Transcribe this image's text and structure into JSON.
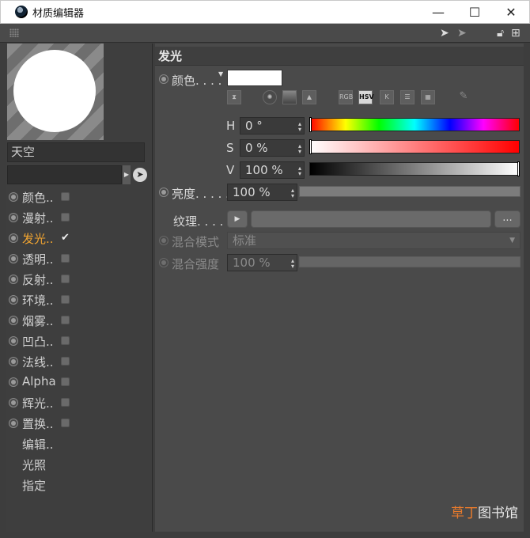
{
  "window": {
    "title": "材质编辑器",
    "controls": {
      "minimize": "—",
      "maximize": "☐",
      "close": "✕"
    }
  },
  "preview": {
    "material_name": "天空"
  },
  "channels": [
    {
      "label": "颜色..",
      "checked": false,
      "active": false
    },
    {
      "label": "漫射..",
      "checked": false,
      "active": false
    },
    {
      "label": "发光..",
      "checked": true,
      "active": true
    },
    {
      "label": "透明..",
      "checked": false,
      "active": false
    },
    {
      "label": "反射..",
      "checked": false,
      "active": false
    },
    {
      "label": "环境..",
      "checked": false,
      "active": false
    },
    {
      "label": "烟雾..",
      "checked": false,
      "active": false
    },
    {
      "label": "凹凸..",
      "checked": false,
      "active": false
    },
    {
      "label": "法线..",
      "checked": false,
      "active": false
    },
    {
      "label": "Alpha",
      "checked": false,
      "active": false
    },
    {
      "label": "辉光..",
      "checked": false,
      "active": false
    },
    {
      "label": "置换..",
      "checked": false,
      "active": false
    }
  ],
  "extra_items": [
    "编辑..",
    "光照",
    "指定"
  ],
  "section": {
    "title": "发光",
    "color_label": "颜色. . . .",
    "color_value": "#ffffff",
    "mode_buttons": [
      "RGB",
      "HSV",
      "K"
    ],
    "mode_selected": "HSV",
    "h": {
      "label": "H",
      "value": "0 °",
      "fraction": 0.0
    },
    "s": {
      "label": "S",
      "value": "0 %",
      "fraction": 0.0
    },
    "v": {
      "label": "V",
      "value": "100 %",
      "fraction": 1.0
    },
    "brightness_label": "亮度. . . . .",
    "brightness_value": "100 %",
    "texture_label": "纹理. . . . .",
    "texture_more": "...",
    "blend_mode_label": "混合模式",
    "blend_mode_value": "标准",
    "blend_strength_label": "混合强度",
    "blend_strength_value": "100 %"
  },
  "watermark": {
    "part1": "草丁",
    "part2": "图书馆"
  }
}
